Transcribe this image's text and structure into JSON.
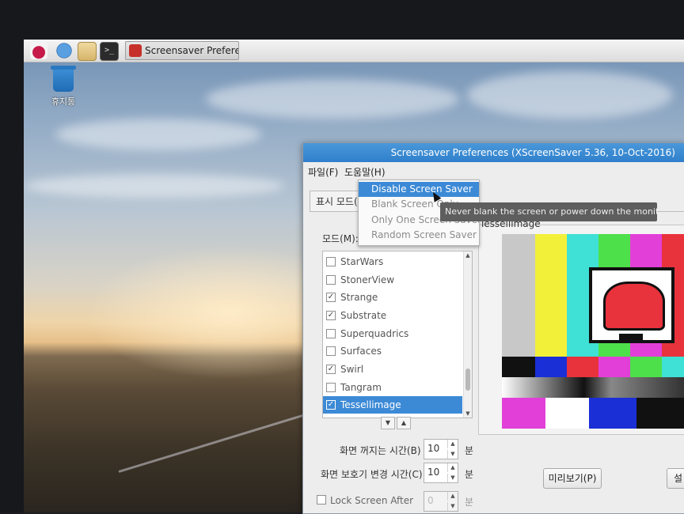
{
  "taskbar": {
    "icons": [
      "raspberry-menu-icon",
      "web-browser-icon",
      "file-manager-icon",
      "terminal-icon"
    ],
    "task_label": "Screensaver Preferen..."
  },
  "desktop": {
    "trash_label": "휴지통"
  },
  "window": {
    "title": "Screensaver Preferences  (XScreenSaver 5.36, 10-Oct-2016)",
    "menu": {
      "file": "파일(F)",
      "help": "도움말(H)"
    },
    "tab_label": "표시 모드(D)",
    "mode_label": "모드(M):",
    "mode_dropdown": {
      "options": [
        "Disable Screen Saver",
        "Blank Screen Only",
        "Only One Screen Saver",
        "Random Screen Saver"
      ],
      "highlighted": "Disable Screen Saver"
    },
    "tooltip": "Never blank the screen or power down the monitor.",
    "screensaver_list": [
      {
        "name": "StarWars",
        "checked": false
      },
      {
        "name": "StonerView",
        "checked": false
      },
      {
        "name": "Strange",
        "checked": true
      },
      {
        "name": "Substrate",
        "checked": true
      },
      {
        "name": "Superquadrics",
        "checked": false
      },
      {
        "name": "Surfaces",
        "checked": false
      },
      {
        "name": "Swirl",
        "checked": true
      },
      {
        "name": "Tangram",
        "checked": false
      },
      {
        "name": "Tessellimage",
        "checked": true,
        "selected": true
      }
    ],
    "blank_after": {
      "label": "화면 꺼지는 시간(B)",
      "value": "10",
      "unit": "분"
    },
    "cycle_after": {
      "label": "화면 보호기 변경 시간(C)",
      "value": "10",
      "unit": "분"
    },
    "lock_after": {
      "label": "Lock Screen After",
      "value": "0",
      "unit": "분"
    },
    "preview_name": "Tessellimage",
    "preview_button": "미리보기(P)",
    "settings_button": "설"
  },
  "colors": {
    "titlebar": "#2f7fcc",
    "selection": "#3c8ad6"
  }
}
